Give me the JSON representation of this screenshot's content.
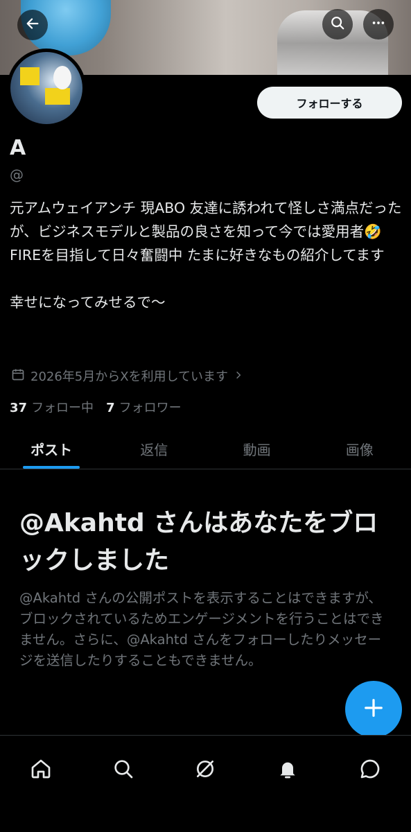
{
  "profile": {
    "display_name": "A",
    "handle": "@",
    "follow_label": "フォローする",
    "bio_lines": [
      "元アムウェイアンチ 現ABO 友達に誘われて怪しさ満点だったが、ビジネスモデルと製品の良さを知って今では愛用者🤣",
      "FIREを目指して日々奮闘中 たまに好きなもの紹介してます",
      "",
      "幸せになってみせるで〜"
    ],
    "joined": "2026年5月からXを利用しています",
    "following_count": "37",
    "following_label": "フォロー中",
    "followers_count": "7",
    "followers_label": "フォロワー"
  },
  "tabs": [
    {
      "label": "ポスト",
      "active": true
    },
    {
      "label": "返信",
      "active": false
    },
    {
      "label": "動画",
      "active": false
    },
    {
      "label": "画像",
      "active": false
    }
  ],
  "block_notice": {
    "title": "@Akahtd さんはあなたをブロックしました",
    "description": "@Akahtd さんの公開ポストを表示することはできますが、ブロックされているためエンゲージメントを行うことはできません。さらに、@Akahtd さんをフォローしたりメッセージを送信したりすることもできません。"
  },
  "icons": {
    "back": "back-arrow-icon",
    "search": "search-icon",
    "more": "more-icon",
    "calendar": "calendar-icon",
    "chevron": "chevron-right-icon",
    "compose": "plus-icon",
    "nav": [
      "home-icon",
      "search-icon",
      "grok-icon",
      "notifications-icon",
      "messages-icon"
    ]
  },
  "colors": {
    "background": "#000000",
    "accent": "#1d9bf0",
    "text_primary": "#e7e9ea",
    "text_secondary": "#71767b",
    "follow_button_bg": "#eff3f4"
  }
}
